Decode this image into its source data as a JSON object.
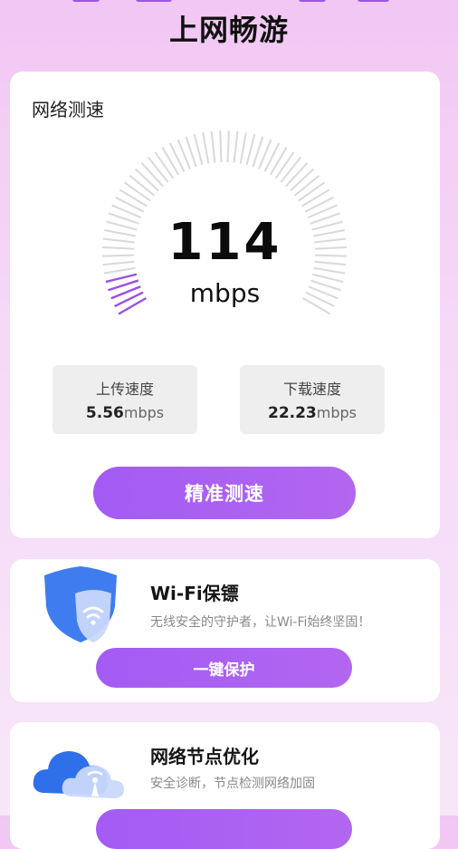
{
  "header": {
    "title": "上网畅游"
  },
  "speed_test": {
    "title": "网络测速",
    "speed_value": "114",
    "speed_unit": "mbps",
    "upload": {
      "label": "上传速度",
      "value": "5.56",
      "unit": "mbps"
    },
    "download": {
      "label": "下载速度",
      "value": "22.23",
      "unit": "mbps"
    },
    "gauge_fraction": 0.08,
    "button_label": "精准测速"
  },
  "features": [
    {
      "icon": "wifi-shield-icon",
      "title": "Wi-Fi保镖",
      "desc": "无线安全的守护者，让Wi-Fi始终坚固！",
      "button_label": "一键保护"
    },
    {
      "icon": "cloud-signal-icon",
      "title": "网络节点优化",
      "desc": "安全诊断，节点检测网络加固",
      "button_label": ""
    }
  ],
  "colors": {
    "accent": "#a35bf4",
    "gauge_active": "#9b4fe6",
    "gauge_inactive": "#d9d9d9"
  }
}
